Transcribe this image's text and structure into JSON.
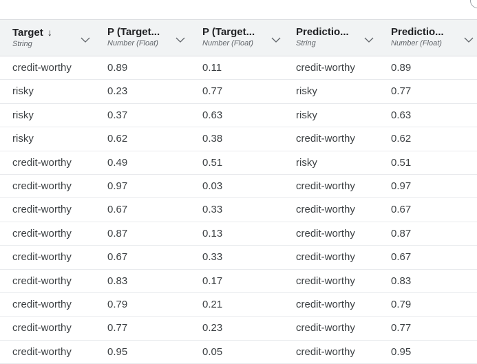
{
  "columns": [
    {
      "title": "Target",
      "type": "String",
      "sort_icon": "arrow-down-icon"
    },
    {
      "title": "P (Target...",
      "type": "Number (Float)"
    },
    {
      "title": "P (Target...",
      "type": "Number (Float)"
    },
    {
      "title": "Predictio...",
      "type": "String"
    },
    {
      "title": "Predictio...",
      "type": "Number (Float)"
    }
  ],
  "sort_arrow": "↓",
  "rows": [
    [
      "credit-worthy",
      "0.89",
      "0.11",
      "credit-worthy",
      "0.89"
    ],
    [
      "risky",
      "0.23",
      "0.77",
      "risky",
      "0.77"
    ],
    [
      "risky",
      "0.37",
      "0.63",
      "risky",
      "0.63"
    ],
    [
      "risky",
      "0.62",
      "0.38",
      "credit-worthy",
      "0.62"
    ],
    [
      "credit-worthy",
      "0.49",
      "0.51",
      "risky",
      "0.51"
    ],
    [
      "credit-worthy",
      "0.97",
      "0.03",
      "credit-worthy",
      "0.97"
    ],
    [
      "credit-worthy",
      "0.67",
      "0.33",
      "credit-worthy",
      "0.67"
    ],
    [
      "credit-worthy",
      "0.87",
      "0.13",
      "credit-worthy",
      "0.87"
    ],
    [
      "credit-worthy",
      "0.67",
      "0.33",
      "credit-worthy",
      "0.67"
    ],
    [
      "credit-worthy",
      "0.83",
      "0.17",
      "credit-worthy",
      "0.83"
    ],
    [
      "credit-worthy",
      "0.79",
      "0.21",
      "credit-worthy",
      "0.79"
    ],
    [
      "credit-worthy",
      "0.77",
      "0.23",
      "credit-worthy",
      "0.77"
    ],
    [
      "credit-worthy",
      "0.95",
      "0.05",
      "credit-worthy",
      "0.95"
    ]
  ]
}
